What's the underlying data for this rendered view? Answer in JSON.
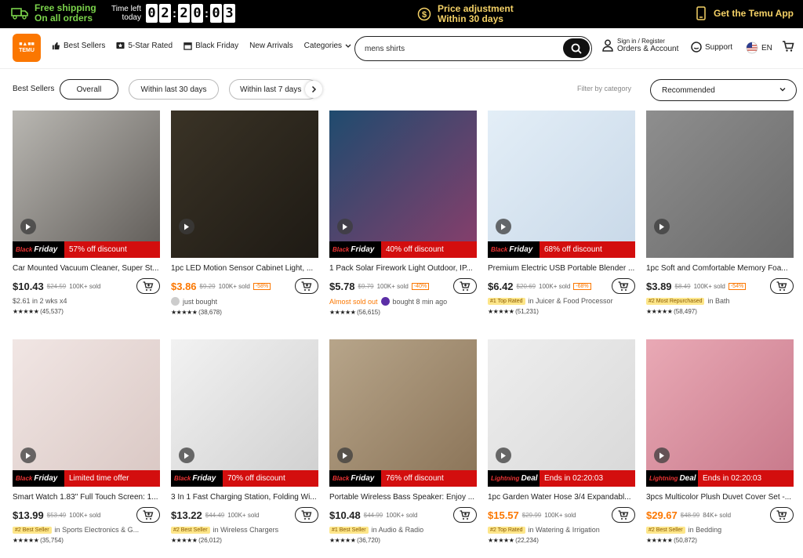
{
  "topbar": {
    "shipping_line1": "Free shipping",
    "shipping_line2": "On all orders",
    "timer_label1": "Time left",
    "timer_label2": "today",
    "timer_digits": [
      "0",
      "2",
      "2",
      "0",
      "0",
      "3"
    ],
    "price_adj_line1": "Price adjustment",
    "price_adj_line2": "Within 30 days",
    "get_app": "Get the Temu App"
  },
  "nav": {
    "logo_text": "TEMU",
    "items": [
      "Best Sellers",
      "5-Star Rated",
      "Black Friday",
      "New Arrivals",
      "Categories"
    ],
    "search_value": "mens shirts",
    "account_line1": "Sign in / Register",
    "account_line2": "Orders & Account",
    "support": "Support",
    "lang": "EN"
  },
  "filters": {
    "label": "Best Sellers",
    "pills": [
      "Overall",
      "Within last 30 days",
      "Within last 7 days"
    ],
    "category_label": "Filter by category",
    "sort_value": "Recommended"
  },
  "products": [
    {
      "title": "Car Mounted Vacuum Cleaner, Super St...",
      "price": "$10.43",
      "old": "$24.59",
      "sold": "100K+ sold",
      "pct": "",
      "orange": false,
      "deal": "57% off discount",
      "deal_type": "bf",
      "meta_badge": "",
      "meta_text": "$2.61 in 2 wks x4",
      "meta_orange": "",
      "rating_count": "(45,537)",
      "thumb_colors": [
        "#b9b7b2",
        "#5f5b57"
      ]
    },
    {
      "title": "1pc LED Motion Sensor Cabinet Light, ...",
      "price": "$3.86",
      "old": "$9.29",
      "sold": "100K+ sold",
      "pct": "-58%",
      "orange": true,
      "deal": "",
      "deal_type": "none",
      "meta_badge": "",
      "meta_text": "just bought",
      "meta_orange": "",
      "rating_count": "(38,678)",
      "thumb_colors": [
        "#3a3326",
        "#1e1a14"
      ]
    },
    {
      "title": "1 Pack Solar Firework Light Outdoor, IP...",
      "price": "$5.78",
      "old": "$9.79",
      "sold": "100K+ sold",
      "pct": "-40%",
      "orange": false,
      "deal": "40% off discount",
      "deal_type": "bf",
      "meta_badge": "",
      "meta_text": "bought 8 min ago",
      "meta_orange": "Almost sold out",
      "rating_count": "(56,615)",
      "thumb_colors": [
        "#1f4b6e",
        "#8a3e6c"
      ]
    },
    {
      "title": "Premium Electric USB Portable Blender ...",
      "price": "$6.42",
      "old": "$20.69",
      "sold": "100K+ sold",
      "pct": "-68%",
      "orange": false,
      "deal": "68% off discount",
      "deal_type": "bf",
      "meta_badge": "#1 Top Rated",
      "meta_text": "in Juicer & Food Processor",
      "meta_orange": "",
      "rating_count": "(51,231)",
      "thumb_colors": [
        "#e3eef7",
        "#c8d8e8"
      ]
    },
    {
      "title": "1pc Soft and Comfortable Memory Foa...",
      "price": "$3.89",
      "old": "$8.49",
      "sold": "100K+ sold",
      "pct": "-54%",
      "orange": false,
      "deal": "",
      "deal_type": "none",
      "meta_badge": "#2 Most Repurchased",
      "meta_text": "in Bath",
      "meta_orange": "",
      "rating_count": "(58,497)",
      "thumb_colors": [
        "#8e8e8e",
        "#6a6a6a"
      ]
    },
    {
      "title": "Smart Watch 1.83'' Full Touch Screen: 1...",
      "price": "$13.99",
      "old": "$53.49",
      "sold": "100K+ sold",
      "pct": "",
      "orange": false,
      "deal": "Limited time offer",
      "deal_type": "bf",
      "meta_badge": "#2 Best Seller",
      "meta_text": "in Sports Electronics & G...",
      "meta_orange": "",
      "rating_count": "(35,754)",
      "thumb_colors": [
        "#f1e6e4",
        "#d9c7c3"
      ]
    },
    {
      "title": "3 In 1 Fast Charging Station, Folding Wi...",
      "price": "$13.22",
      "old": "$44.49",
      "sold": "100K+ sold",
      "pct": "",
      "orange": false,
      "deal": "70% off discount",
      "deal_type": "bf",
      "meta_badge": "#2 Best Seller",
      "meta_text": "in Wireless Chargers",
      "meta_orange": "",
      "rating_count": "(26,012)",
      "thumb_colors": [
        "#f2f2f2",
        "#cfcfcf"
      ]
    },
    {
      "title": "Portable Wireless Bass Speaker: Enjoy ...",
      "price": "$10.48",
      "old": "$44.99",
      "sold": "100K+ sold",
      "pct": "",
      "orange": false,
      "deal": "76% off discount",
      "deal_type": "bf",
      "meta_badge": "#1 Best Seller",
      "meta_text": "in Audio & Radio",
      "meta_orange": "",
      "rating_count": "(36,720)",
      "thumb_colors": [
        "#b7a58a",
        "#8a7357"
      ]
    },
    {
      "title": "1pc Garden Water Hose 3/4 Expandabl...",
      "price": "$15.57",
      "old": "$29.99",
      "sold": "100K+ sold",
      "pct": "",
      "orange": true,
      "deal": "Ends in 02:20:03",
      "deal_type": "ld",
      "meta_badge": "#2 Top Rated",
      "meta_text": "in Watering & Irrigation",
      "meta_orange": "",
      "rating_count": "(22,234)",
      "thumb_colors": [
        "#eeeeee",
        "#d8d8d8"
      ]
    },
    {
      "title": "3pcs Multicolor Plush Duvet Cover Set -...",
      "price": "$29.67",
      "old": "$48.99",
      "sold": "84K+ sold",
      "pct": "",
      "orange": true,
      "deal": "Ends in 02:20:03",
      "deal_type": "ld",
      "meta_badge": "#2 Best Seller",
      "meta_text": "in Bedding",
      "meta_orange": "",
      "rating_count": "(50,872)",
      "thumb_colors": [
        "#e9a9b5",
        "#c7788a"
      ]
    }
  ],
  "deal_tag": {
    "bf_small": "Black",
    "bf_big": "Friday",
    "ld_small": "Lightning",
    "ld_big": "Deal"
  }
}
